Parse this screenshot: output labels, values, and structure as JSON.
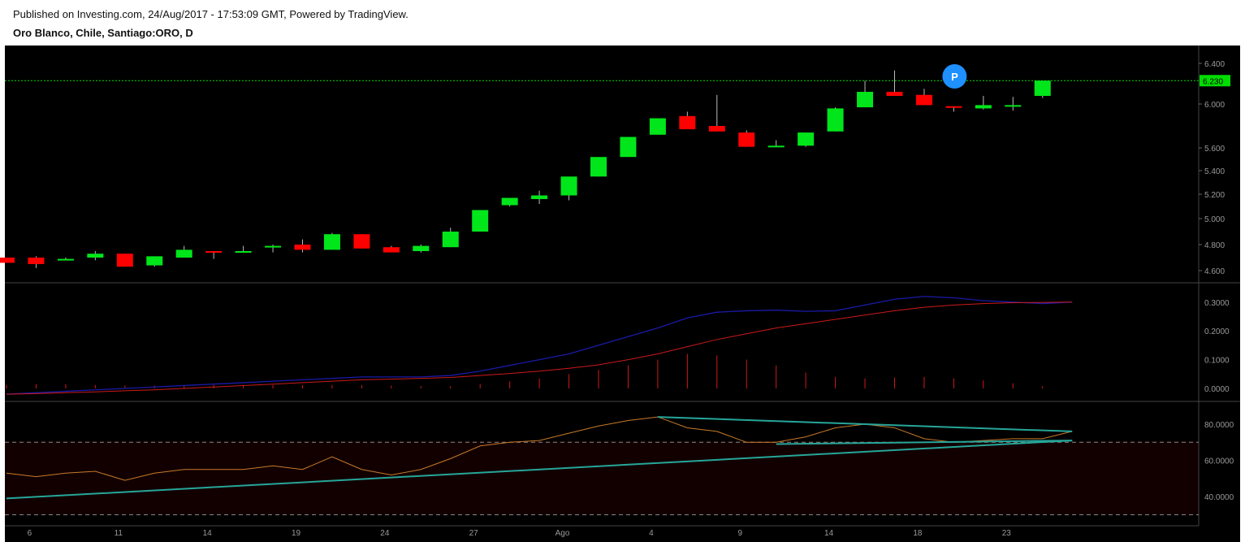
{
  "header": {
    "published": "Published on Investing.com, 24/Aug/2017 - 17:53:09 GMT, Powered by TradingView.",
    "symbol": "Oro Blanco, Chile, Santiago:ORO, D"
  },
  "colors": {
    "up": "#00e61a",
    "down": "#ff0000",
    "macd": "#1a1aa8",
    "signal": "#cc1a1a",
    "rsi": "#c87a2a",
    "trend": "#26a69a",
    "pricline": "#00dd00",
    "badge": "#1e90ff"
  },
  "chart_data": [
    {
      "type": "candlestick",
      "title": "Oro Blanco, Chile, Santiago:ORO, D",
      "x_tick_labels": [
        "6",
        "11",
        "14",
        "19",
        "24",
        "27",
        "Ago",
        "4",
        "9",
        "14",
        "18",
        "23"
      ],
      "y_ticks": [
        "6.400",
        "6.000",
        "5.600",
        "5.400",
        "5.200",
        "5.000",
        "4.800",
        "4.600"
      ],
      "last_price_label": "6.230",
      "last_price": 6.23,
      "marker_label": "P",
      "candles": [
        {
          "o": 4.7,
          "h": 4.7,
          "l": 4.66,
          "c": 4.66
        },
        {
          "o": 4.7,
          "h": 4.71,
          "l": 4.62,
          "c": 4.65
        },
        {
          "o": 4.69,
          "h": 4.7,
          "l": 4.68,
          "c": 4.69
        },
        {
          "o": 4.7,
          "h": 4.75,
          "l": 4.68,
          "c": 4.73
        },
        {
          "o": 4.73,
          "h": 4.73,
          "l": 4.63,
          "c": 4.63
        },
        {
          "o": 4.64,
          "h": 4.71,
          "l": 4.63,
          "c": 4.71
        },
        {
          "o": 4.7,
          "h": 4.79,
          "l": 4.7,
          "c": 4.76
        },
        {
          "o": 4.75,
          "h": 4.75,
          "l": 4.69,
          "c": 4.74
        },
        {
          "o": 4.74,
          "h": 4.79,
          "l": 4.74,
          "c": 4.75
        },
        {
          "o": 4.78,
          "h": 4.8,
          "l": 4.74,
          "c": 4.79
        },
        {
          "o": 4.8,
          "h": 4.84,
          "l": 4.74,
          "c": 4.76
        },
        {
          "o": 4.76,
          "h": 4.89,
          "l": 4.76,
          "c": 4.88
        },
        {
          "o": 4.88,
          "h": 4.88,
          "l": 4.77,
          "c": 4.77
        },
        {
          "o": 4.78,
          "h": 4.79,
          "l": 4.74,
          "c": 4.74
        },
        {
          "o": 4.75,
          "h": 4.8,
          "l": 4.74,
          "c": 4.79
        },
        {
          "o": 4.78,
          "h": 4.93,
          "l": 4.78,
          "c": 4.9
        },
        {
          "o": 4.9,
          "h": 5.07,
          "l": 4.9,
          "c": 5.07
        },
        {
          "o": 5.11,
          "h": 5.16,
          "l": 5.1,
          "c": 5.17
        },
        {
          "o": 5.16,
          "h": 5.23,
          "l": 5.12,
          "c": 5.19
        },
        {
          "o": 5.19,
          "h": 5.28,
          "l": 5.15,
          "c": 5.35
        },
        {
          "o": 5.35,
          "h": 5.36,
          "l": 5.35,
          "c": 5.52
        },
        {
          "o": 5.52,
          "h": 5.57,
          "l": 5.52,
          "c": 5.7
        },
        {
          "o": 5.72,
          "h": 5.78,
          "l": 5.72,
          "c": 5.87
        },
        {
          "o": 5.89,
          "h": 5.93,
          "l": 5.77,
          "c": 5.77
        },
        {
          "o": 5.8,
          "h": 6.09,
          "l": 5.75,
          "c": 5.75
        },
        {
          "o": 5.74,
          "h": 5.76,
          "l": 5.61,
          "c": 5.61
        },
        {
          "o": 5.62,
          "h": 5.67,
          "l": 5.61,
          "c": 5.62
        },
        {
          "o": 5.62,
          "h": 5.74,
          "l": 5.61,
          "c": 5.74
        },
        {
          "o": 5.75,
          "h": 5.97,
          "l": 5.75,
          "c": 5.96
        },
        {
          "o": 5.97,
          "h": 6.23,
          "l": 5.97,
          "c": 6.12
        },
        {
          "o": 6.12,
          "h": 6.33,
          "l": 6.08,
          "c": 6.08
        },
        {
          "o": 6.09,
          "h": 6.15,
          "l": 5.99,
          "c": 5.99
        },
        {
          "o": 5.98,
          "h": 5.98,
          "l": 5.93,
          "c": 5.97
        },
        {
          "o": 5.96,
          "h": 6.08,
          "l": 5.95,
          "c": 5.99
        },
        {
          "o": 5.98,
          "h": 6.07,
          "l": 5.94,
          "c": 5.99
        },
        {
          "o": 6.08,
          "h": 6.23,
          "l": 6.06,
          "c": 6.23
        }
      ]
    },
    {
      "type": "line",
      "y_ticks": [
        "0.3000",
        "0.2000",
        "0.1000",
        "0.0000"
      ],
      "macd": [
        -0.02,
        -0.015,
        -0.01,
        -0.005,
        0.0,
        0.005,
        0.01,
        0.015,
        0.02,
        0.025,
        0.03,
        0.035,
        0.04,
        0.04,
        0.04,
        0.045,
        0.06,
        0.08,
        0.1,
        0.12,
        0.15,
        0.18,
        0.21,
        0.245,
        0.265,
        0.27,
        0.272,
        0.268,
        0.27,
        0.29,
        0.31,
        0.32,
        0.315,
        0.305,
        0.3,
        0.295,
        0.3
      ],
      "signal": [
        -0.02,
        -0.018,
        -0.015,
        -0.012,
        -0.008,
        -0.005,
        0.0,
        0.005,
        0.01,
        0.015,
        0.02,
        0.025,
        0.03,
        0.032,
        0.035,
        0.038,
        0.045,
        0.052,
        0.06,
        0.07,
        0.082,
        0.1,
        0.12,
        0.145,
        0.17,
        0.19,
        0.21,
        0.225,
        0.24,
        0.255,
        0.27,
        0.282,
        0.29,
        0.295,
        0.298,
        0.299,
        0.3
      ],
      "histogram": [
        0.012,
        0.015,
        0.015,
        0.012,
        0.01,
        0.01,
        0.012,
        0.012,
        0.012,
        0.012,
        0.012,
        0.012,
        0.012,
        0.01,
        0.008,
        0.008,
        0.015,
        0.025,
        0.035,
        0.05,
        0.065,
        0.08,
        0.1,
        0.12,
        0.115,
        0.1,
        0.08,
        0.055,
        0.04,
        0.035,
        0.038,
        0.04,
        0.035,
        0.028,
        0.018,
        0.008,
        0.0
      ]
    },
    {
      "type": "line",
      "y_ticks": [
        "80.0000",
        "60.0000",
        "40.0000"
      ],
      "overbought": 70,
      "oversold": 30,
      "rsi": [
        53,
        51,
        53,
        54,
        49,
        53,
        55,
        55,
        55,
        57,
        55,
        62,
        55,
        52,
        55,
        61,
        68,
        70,
        71,
        75,
        79,
        82,
        84,
        78,
        76,
        70,
        70,
        73,
        78,
        80,
        78,
        72,
        70,
        71,
        72,
        72,
        76
      ],
      "trendlines": [
        {
          "from": [
            0,
            39
          ],
          "to": [
            36,
            71
          ]
        },
        {
          "from": [
            22,
            84
          ],
          "to": [
            36,
            76
          ]
        },
        {
          "from": [
            26,
            69
          ],
          "to": [
            36,
            71
          ]
        }
      ]
    }
  ]
}
